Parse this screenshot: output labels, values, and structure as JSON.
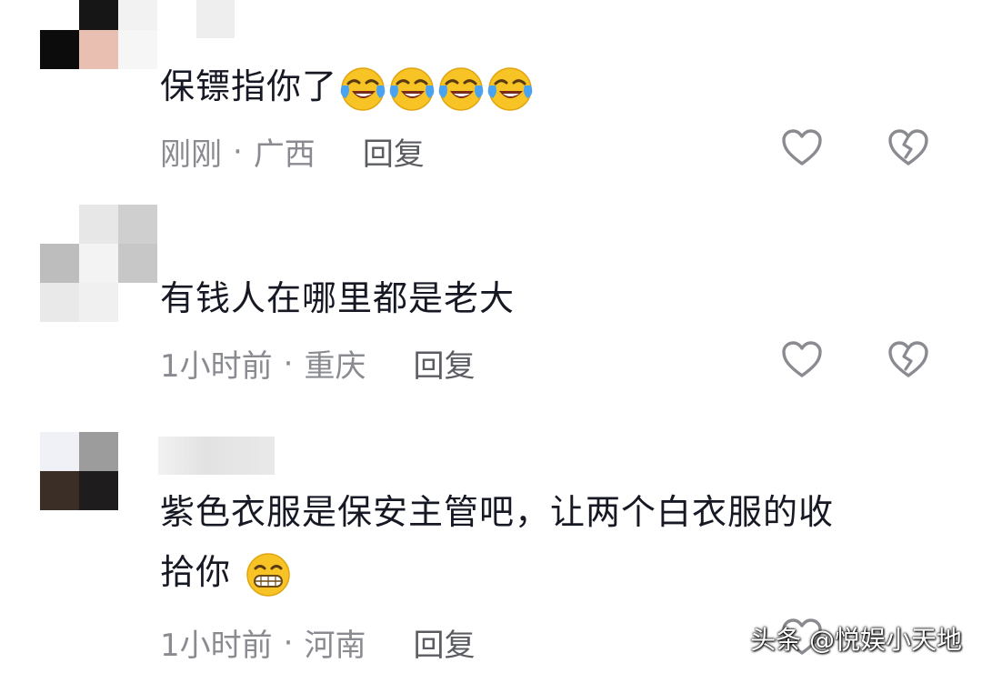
{
  "comments": [
    {
      "text": "保镖指你了",
      "emoji_names": [
        "laugh-cry-icon",
        "laugh-cry-icon",
        "laugh-cry-icon",
        "laugh-cry-icon"
      ],
      "time": "刚刚",
      "location": "广西",
      "reply": "回复"
    },
    {
      "text": "有钱人在哪里都是老大",
      "time": "1小时前",
      "location": "重庆",
      "reply": "回复"
    },
    {
      "text_line1": "紫色衣服是保安主管吧，让两个白衣服的收",
      "text_line2": "拾你",
      "emoji_names": [
        "grin-icon"
      ],
      "time": "1小时前",
      "location": "河南",
      "reply": "回复"
    }
  ],
  "meta_separator": "·",
  "watermark": "头条 @悦娱小天地",
  "colors": {
    "text": "#161823",
    "meta": "#8a8b91",
    "icon": "#8a8b91",
    "emoji_yellow": "#f7c325",
    "tear_blue": "#4aa3f0"
  }
}
